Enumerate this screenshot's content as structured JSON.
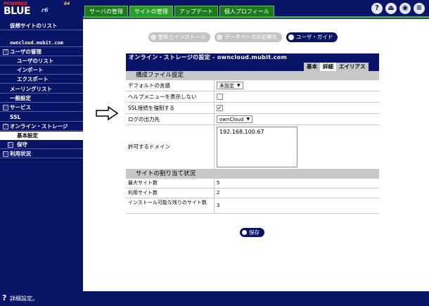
{
  "logo": {
    "powered": "POWERED",
    "brand": "BLUE",
    "version": "64",
    "suffix": "r6"
  },
  "top_tabs": [
    "サーバの管理",
    "サイトの管理",
    "アップデート",
    "個人プロフィール"
  ],
  "top_tab_active": 1,
  "top_icons": [
    "help-icon",
    "logout-icon",
    "eye-icon",
    "menu-icon"
  ],
  "sidebar": {
    "items": [
      {
        "label": "仮想サイトのリスト",
        "kind": "top"
      },
      {
        "label": "owncloud.mubit.com",
        "kind": "top"
      },
      {
        "label": "ユーザの管理",
        "kind": "group-open"
      },
      {
        "label": "ユーザのリスト",
        "kind": "sub"
      },
      {
        "label": "インポート",
        "kind": "sub"
      },
      {
        "label": "エクスポート",
        "kind": "sub"
      },
      {
        "label": "メーリングリスト",
        "kind": "top"
      },
      {
        "label": "一般設定",
        "kind": "top"
      },
      {
        "label": "サービス",
        "kind": "group-closed"
      },
      {
        "label": "SSL",
        "kind": "top"
      },
      {
        "label": "オンライン・ストレージ",
        "kind": "group-open"
      },
      {
        "label": "基本設定",
        "kind": "sub-selected"
      },
      {
        "label": "保守",
        "kind": "sub-closed"
      },
      {
        "label": "利用状況",
        "kind": "group-closed"
      }
    ]
  },
  "actions": {
    "update_install": "更新とインストール",
    "db_init": "データベースの初期化",
    "user_guide": "ユーザ・ガイド"
  },
  "panel": {
    "title": "オンライン・ストレージの設定 - owncloud.mubit.com",
    "tabs": [
      "基本",
      "詳細",
      "エイリアス"
    ],
    "active_tab": 1,
    "section_config": "構成ファイル設定",
    "fields": {
      "default_language_label": "デフォルトの言語",
      "default_language_value": "未設定",
      "hide_help_label": "ヘルプメニューを表示しない",
      "hide_help_checked": false,
      "force_ssl_label": "SSL接続を強制する",
      "force_ssl_checked": true,
      "log_output_label": "ログの出力先",
      "log_output_value": "ownCloud",
      "allowed_domains_label": "許可するドメイン",
      "allowed_domains_value": "192.168.100.67"
    },
    "section_quota": "サイトの割り当て状況",
    "quota": {
      "max_sites_label": "最大サイト数",
      "max_sites_value": "5",
      "used_sites_label": "利用サイト数",
      "used_sites_value": "2",
      "remaining_label": "インストール可能な残りのサイト数",
      "remaining_value": "3"
    },
    "save_label": "保存"
  },
  "status_bar": {
    "text": "詳細設定。"
  }
}
